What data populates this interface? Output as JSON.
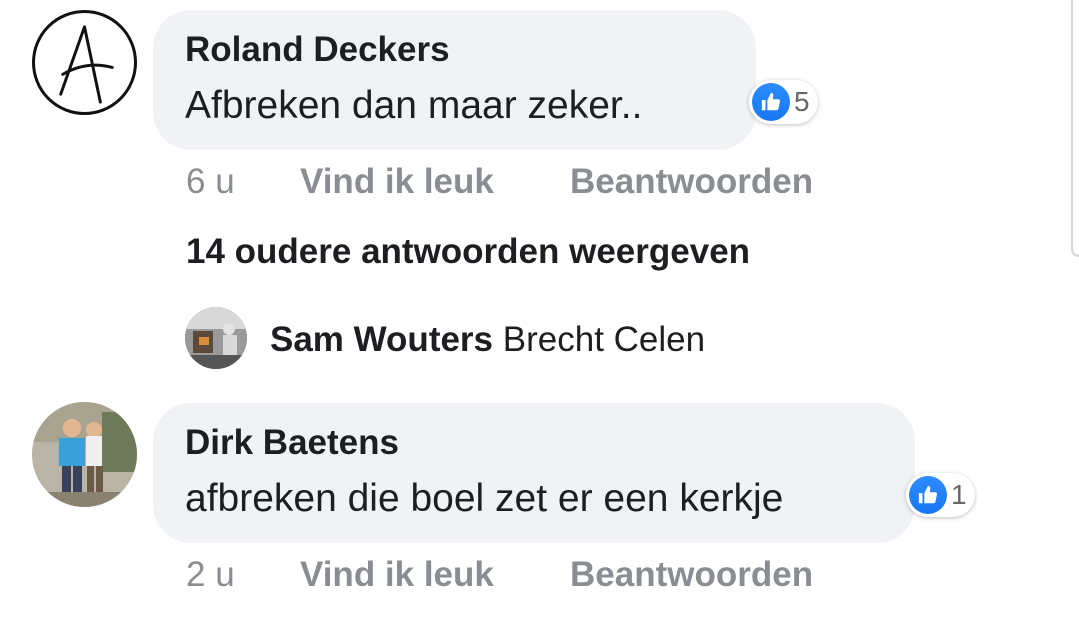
{
  "comments": [
    {
      "author": "Roland Deckers",
      "text": "Afbreken dan maar zeker..",
      "reactions": 5,
      "time": "6 u",
      "like_label": "Vind ik leuk",
      "reply_label": "Beantwoorden"
    },
    {
      "author": "Dirk Baetens",
      "text": "afbreken die boel zet er een kerkje",
      "reactions": 1,
      "time": "2 u",
      "like_label": "Vind ik leuk",
      "reply_label": "Beantwoorden"
    }
  ],
  "more_replies_label": "14 oudere antwoorden weergeven",
  "latest_reply": {
    "author": "Sam Wouters",
    "text": "Brecht Celen"
  },
  "colors": {
    "bubble": "#f0f2f5",
    "like_blue": "#1877f2",
    "meta_gray": "#8a8d91"
  }
}
